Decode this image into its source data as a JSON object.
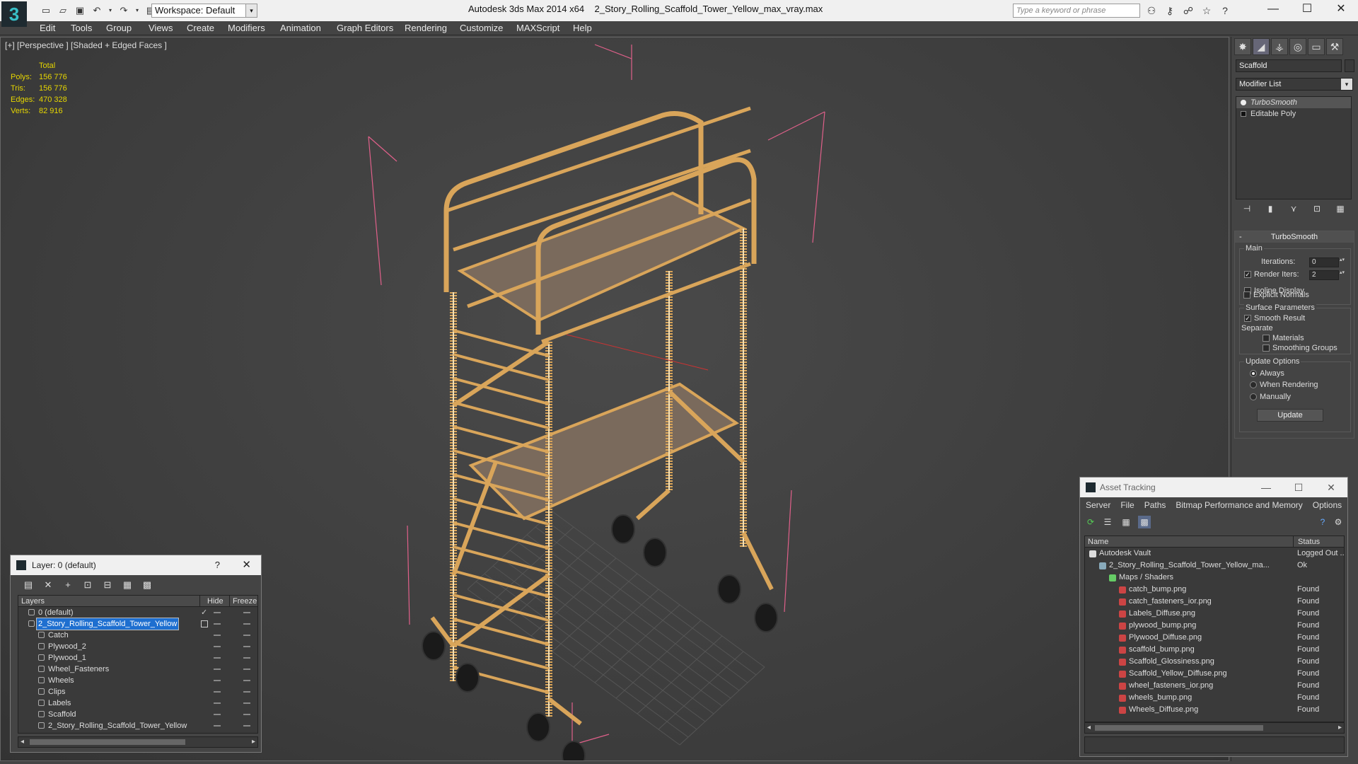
{
  "app": {
    "title": "Autodesk 3ds Max  2014 x64",
    "file": "2_Story_Rolling_Scaffold_Tower_Yellow_max_vray.max",
    "workspace": "Workspace: Default",
    "search_placeholder": "Type a keyword or phrase"
  },
  "menu": [
    "Edit",
    "Tools",
    "Group",
    "Views",
    "Create",
    "Modifiers",
    "Animation",
    "Graph Editors",
    "Rendering",
    "Customize",
    "MAXScript",
    "Help"
  ],
  "viewport": {
    "label": "[+] [Perspective ] [Shaded + Edged Faces ]",
    "stats": {
      "header": "Total",
      "rows": [
        {
          "k": "Polys:",
          "v": "156 776"
        },
        {
          "k": "Tris:",
          "v": "156 776"
        },
        {
          "k": "Edges:",
          "v": "470 328"
        },
        {
          "k": "Verts:",
          "v": "82 916"
        }
      ]
    }
  },
  "command_panel": {
    "object_name": "Scaffold",
    "modifier_list": "Modifier List",
    "stack": [
      "TurboSmooth",
      "Editable Poly"
    ],
    "turbosmooth": {
      "title": "TurboSmooth",
      "main": "Main",
      "iterations_label": "Iterations:",
      "iterations": "0",
      "render_iters_label": "Render Iters:",
      "render_iters": "2",
      "isoline": "Isoline Display",
      "explicit": "Explicit Normals",
      "surface": "Surface Parameters",
      "smooth_result": "Smooth Result",
      "separate": "Separate",
      "materials": "Materials",
      "smoothing_groups": "Smoothing Groups",
      "update_options": "Update Options",
      "always": "Always",
      "when_rendering": "When Rendering",
      "manually": "Manually",
      "update_btn": "Update"
    }
  },
  "layer": {
    "title": "Layer: 0 (default)",
    "help": "?",
    "headers": {
      "layers": "Layers",
      "hide": "Hide",
      "freeze": "Freeze"
    },
    "rows": [
      {
        "name": "0 (default)",
        "level": 1,
        "check": true
      },
      {
        "name": "2_Story_Rolling_Scaffold_Tower_Yellow",
        "level": 1,
        "selected": true
      },
      {
        "name": "Catch",
        "level": 2
      },
      {
        "name": "Plywood_2",
        "level": 2
      },
      {
        "name": "Plywood_1",
        "level": 2
      },
      {
        "name": "Wheel_Fasteners",
        "level": 2
      },
      {
        "name": "Wheels",
        "level": 2
      },
      {
        "name": "Clips",
        "level": 2
      },
      {
        "name": "Labels",
        "level": 2
      },
      {
        "name": "Scaffold",
        "level": 2
      },
      {
        "name": "2_Story_Rolling_Scaffold_Tower_Yellow",
        "level": 2
      }
    ]
  },
  "asset": {
    "title": "Asset Tracking",
    "menu": [
      "Server",
      "File",
      "Paths",
      "Bitmap Performance and Memory",
      "Options"
    ],
    "headers": {
      "name": "Name",
      "status": "Status"
    },
    "rows": [
      {
        "name": "Autodesk Vault",
        "status": "Logged Out ...",
        "level": 0,
        "kind": "vault"
      },
      {
        "name": "2_Story_Rolling_Scaffold_Tower_Yellow_ma...",
        "status": "Ok",
        "level": 1,
        "kind": "file"
      },
      {
        "name": "Maps / Shaders",
        "status": "",
        "level": 2,
        "kind": "maps"
      },
      {
        "name": "catch_bump.png",
        "status": "Found",
        "level": 3,
        "kind": "png"
      },
      {
        "name": "catch_fasteners_ior.png",
        "status": "Found",
        "level": 3,
        "kind": "png"
      },
      {
        "name": "Labels_Diffuse.png",
        "status": "Found",
        "level": 3,
        "kind": "png"
      },
      {
        "name": "plywood_bump.png",
        "status": "Found",
        "level": 3,
        "kind": "png"
      },
      {
        "name": "Plywood_Diffuse.png",
        "status": "Found",
        "level": 3,
        "kind": "png"
      },
      {
        "name": "scaffold_bump.png",
        "status": "Found",
        "level": 3,
        "kind": "png"
      },
      {
        "name": "Scaffold_Glossiness.png",
        "status": "Found",
        "level": 3,
        "kind": "png"
      },
      {
        "name": "Scaffold_Yellow_Diffuse.png",
        "status": "Found",
        "level": 3,
        "kind": "png"
      },
      {
        "name": "wheel_fasteners_ior.png",
        "status": "Found",
        "level": 3,
        "kind": "png"
      },
      {
        "name": "wheels_bump.png",
        "status": "Found",
        "level": 3,
        "kind": "png"
      },
      {
        "name": "Wheels_Diffuse.png",
        "status": "Found",
        "level": 3,
        "kind": "png"
      }
    ]
  },
  "colors": {
    "scaffold": "#d9a55a",
    "plywood": "#7a6a5c",
    "bbox": "#e0608a",
    "stats": "#e6d600",
    "selection": "#1e6fd0"
  },
  "icons": {
    "logo": "3ds-max-logo-icon",
    "close": "close-icon",
    "help": "help-icon"
  }
}
